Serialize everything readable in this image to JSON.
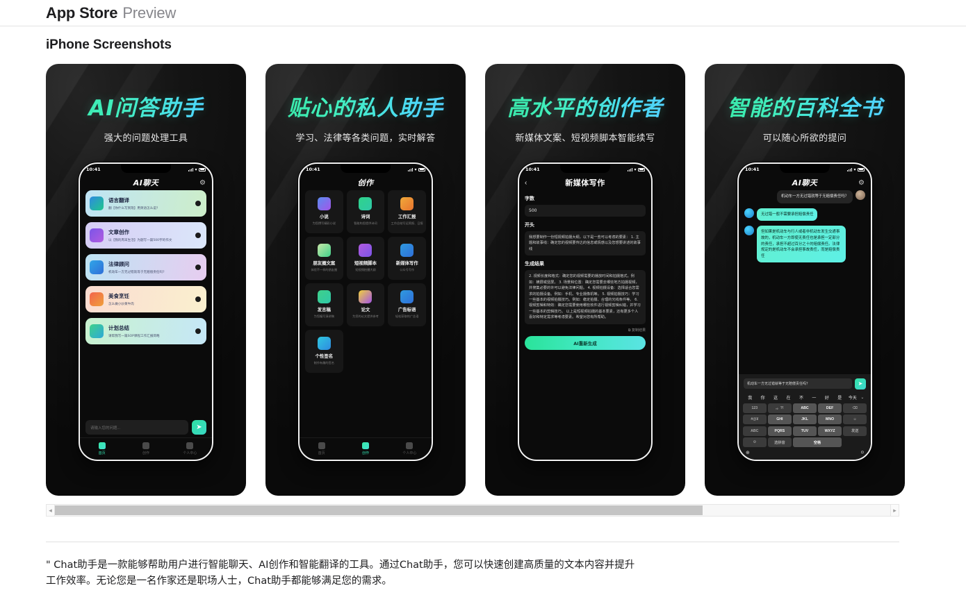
{
  "header": {
    "title_bold": "App Store",
    "title_light": "Preview"
  },
  "section": {
    "title": "iPhone Screenshots"
  },
  "scrollbar": {
    "left_arrow": "◂",
    "right_arrow": "▸"
  },
  "description": {
    "text": "\" Chat助手是一款能够帮助用户进行智能聊天、AI创作和智能翻译的工具。通过Chat助手，您可以快速创建高质量的文本内容并提升工作效率。无论您是一名作家还是职场人士，Chat助手都能够满足您的需求。"
  },
  "shots": [
    {
      "title": "AI问答助手",
      "subtitle": "强大的问题处理工具",
      "phone": {
        "status_time": "10:41",
        "app_name": "AI聊天",
        "gear_icon": "⚙",
        "cards": [
          {
            "name": "语言翻译",
            "desc": "翻【你什么写到现】用英语怎么说?",
            "color": "linear-gradient(100deg,#bfe4f5,#cdeec9)",
            "icon": "linear-gradient(135deg,#2f8ae0,#1fc78c)"
          },
          {
            "name": "文章创作",
            "desc": "以【我的周末生活】为题写一篇500字的作文",
            "color": "linear-gradient(100deg,#d6cdf5,#dbe7fa)",
            "icon": "linear-gradient(135deg,#7b55e8,#b25be0)"
          },
          {
            "name": "法律顾问",
            "desc": "机动车一方无过错就等于无赔偿责任吗?",
            "color": "linear-gradient(100deg,#bde3f3,#e7cdf0)",
            "icon": "linear-gradient(135deg,#31a5e8,#2f6fd8)"
          },
          {
            "name": "美食烹饪",
            "desc": "怎么做小炒黄牛肉",
            "color": "linear-gradient(100deg,#fbdcd0,#faf0cf)",
            "icon": "linear-gradient(135deg,#f2644c,#f0a03a)"
          },
          {
            "name": "计划总结",
            "desc": "请帮我写一篇SOP课程工作汇报简略",
            "color": "linear-gradient(100deg,#c8f2cf,#c6e7f7)",
            "icon": "linear-gradient(135deg,#3fd18a,#2fa9d8)"
          }
        ],
        "composer_placeholder": "请输入您的问题...",
        "send_icon": "➤",
        "tabs": [
          {
            "label": "首页",
            "active": true
          },
          {
            "label": "创作",
            "active": false
          },
          {
            "label": "个人中心",
            "active": false
          }
        ]
      }
    },
    {
      "title": "贴心的私人助手",
      "subtitle": "学习、法律等各类问题，实时解答",
      "phone": {
        "status_time": "10:41",
        "app_name": "创作",
        "tiles": [
          {
            "name": "小说",
            "desc": "为您撰写精彩小说",
            "icon": "linear-gradient(135deg,#5a8cf0,#a455e8)"
          },
          {
            "name": "诗词",
            "desc": "智能构思提供诗词",
            "icon": "linear-gradient(135deg,#2fd48a,#2fc8a8)"
          },
          {
            "name": "工作汇报",
            "desc": "工作总结写运简报、日报",
            "icon": "linear-gradient(135deg,#f0a93a,#e8742f)"
          },
          {
            "name": "朋友圈文案",
            "desc": "体验不一样的朋友圈",
            "icon": "linear-gradient(135deg,#c8e8a8,#3fd18a)"
          },
          {
            "name": "短视频脚本",
            "desc": "短视频拍摄大纲",
            "icon": "linear-gradient(135deg,#b25be0,#7b55e8)"
          },
          {
            "name": "新媒体写作",
            "desc": "公众号写作",
            "icon": "linear-gradient(135deg,#2f9ae0,#2f6fd8)"
          },
          {
            "name": "发言稿",
            "desc": "为您编写演讲稿",
            "icon": "linear-gradient(135deg,#3fd18a,#2fc8a8)"
          },
          {
            "name": "论文",
            "desc": "为您的论文提供参考",
            "icon": "linear-gradient(135deg,#f0d03a,#a455e8)"
          },
          {
            "name": "广告标语",
            "desc": "轻松获取的广告语",
            "icon": "linear-gradient(135deg,#2f9ae0,#2f6fd8)"
          },
          {
            "name": "个性签名",
            "desc": "制作有趣的签名",
            "icon": "linear-gradient(135deg,#2fc8e0,#2f8ae0)"
          }
        ],
        "tabs": [
          {
            "label": "首页",
            "active": false
          },
          {
            "label": "创作",
            "active": true
          },
          {
            "label": "个人中心",
            "active": false
          }
        ]
      }
    },
    {
      "title": "高水平的创作者",
      "subtitle": "新媒体文案、短视频脚本智能续写",
      "phone": {
        "status_time": "10:41",
        "app_name": "新媒体写作",
        "back_icon": "‹",
        "label_count": "字数",
        "value_count": "500",
        "label_start": "开头",
        "value_start": "我想要制作一份短视频拍摄大纲，以下是一些可以考虑的要素：\n1. 主题和故事线：确定您的视频要传达的信息或情感以及您想要讲述的故事线",
        "label_result": "生成结果",
        "value_result": "2. 视频长度和格式：确定您的视频需要的播放时间和拍摄格式。例如：横屏或竖屏。\n3. 场景和位置：确定您需要去哪些地方拍摄视频，并搜集必要的许可以避免法律问题。\n4. 视频拍摄设备：选择适合您需求的拍摄设备。例如：手机、专业摄像机等。\n5. 视频拍摄技巧：学习一些基本的视频拍摄技巧。例如：稳定拍摄、合理的光线条件等。\n6. 视频剪辑和特效：确定您需要使用哪些软件进行视频剪辑纠错，并学习一些基本的剪辑技巧。\n以上是短视频拍摄的基本要素，还有更多个人喜好和特定需求等考虑要素。希望对您有所帮助。",
        "copy_label": "复制结果",
        "copy_icon": "⧉",
        "regen_button": "AI重新生成"
      }
    },
    {
      "title": "智能的百科全书",
      "subtitle": "可以随心所欲的提问",
      "phone": {
        "status_time": "10:41",
        "app_name": "AI聊天",
        "gear_icon": "⚙",
        "messages": [
          {
            "from": "me",
            "text": "机动车一方无过错就等于无赔偿责任吗？"
          },
          {
            "from": "bot",
            "text": "无过错一般不需要承担赔偿责任"
          },
          {
            "from": "bot",
            "text": "但如果是机动车与行人或者非机动车发生交通事故的，机动车一方即使无责任也是承担一定部分的责任，承担不超过百分之十的赔偿责任。法律规定的是机动车不会承担事故责任，而是赔偿责任"
          }
        ],
        "input_value": "机动车一方无过错就等于无赔偿责任吗？",
        "send_icon": "➤",
        "suggestions": [
          "我",
          "你",
          "这",
          "在",
          "不",
          "一",
          "好",
          "是",
          "今天"
        ],
        "suggestion_more_icon": "⌄",
        "keys": [
          {
            "label": "123",
            "dim": true
          },
          {
            "label": ",。?!",
            "dim": true
          },
          {
            "label": "ABC",
            "dim": false
          },
          {
            "label": "DEF",
            "dim": false
          },
          {
            "label": "⌫",
            "dim": true
          },
          {
            "label": "#@¥",
            "dim": true
          },
          {
            "label": "GHI",
            "dim": false
          },
          {
            "label": "JKL",
            "dim": false
          },
          {
            "label": "MNO",
            "dim": false
          },
          {
            "label": "☺",
            "dim": true
          },
          {
            "label": "ABC",
            "dim": true
          },
          {
            "label": "PQRS",
            "dim": false
          },
          {
            "label": "TUV",
            "dim": false
          },
          {
            "label": "WXYZ",
            "dim": false
          },
          {
            "label": "发送",
            "dim": true
          },
          {
            "label": "⚙",
            "dim": true
          },
          {
            "label": "选拼音",
            "dim": true
          },
          {
            "label": "空格",
            "dim": false
          }
        ],
        "globe_icon": "⊕",
        "mic_icon": "ᴑ"
      }
    }
  ]
}
